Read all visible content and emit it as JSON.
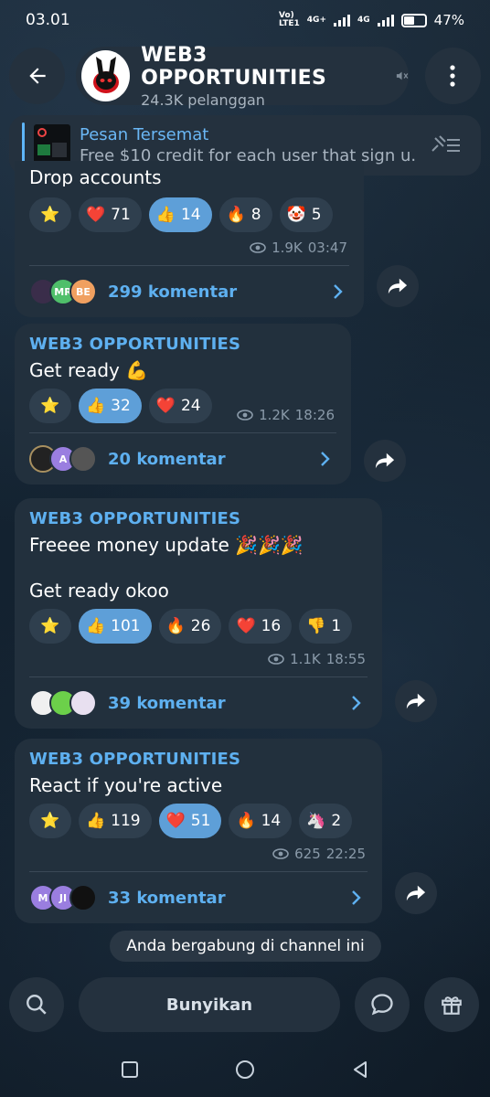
{
  "status": {
    "time": "03.01",
    "net_top": "Vo)",
    "net_bottom": "LTE1",
    "gen1": "4G+",
    "gen2": "4G",
    "battery": "47%"
  },
  "header": {
    "channel_name": "WEB3 OPPORTUNITIES",
    "subscribers": "24.3K pelanggan"
  },
  "pinned": {
    "title": "Pesan Tersemat",
    "text": "Free $10 credit for each user that sign u..."
  },
  "posts": [
    {
      "text": "Drop accounts",
      "reactions": [
        {
          "icon": "star",
          "count": ""
        },
        {
          "icon": "heart",
          "count": "71"
        },
        {
          "icon": "thumbs-up",
          "count": "14",
          "active": true
        },
        {
          "icon": "fire",
          "count": "8"
        },
        {
          "icon": "clown",
          "count": "5"
        }
      ],
      "views": "1.9K",
      "time": "03:47",
      "comments": "299 komentar"
    },
    {
      "sender": "WEB3 OPPORTUNITIES",
      "text": "Get ready 💪",
      "reactions": [
        {
          "icon": "star",
          "count": ""
        },
        {
          "icon": "thumbs-up",
          "count": "32",
          "active": true
        },
        {
          "icon": "heart",
          "count": "24"
        }
      ],
      "views": "1.2K",
      "time": "18:26",
      "comments": "20 komentar"
    },
    {
      "sender": "WEB3 OPPORTUNITIES",
      "text": "Freeee money update 🎉🎉🎉",
      "text2": "Get ready okoo",
      "reactions": [
        {
          "icon": "star",
          "count": ""
        },
        {
          "icon": "thumbs-up",
          "count": "101",
          "active": true
        },
        {
          "icon": "fire",
          "count": "26"
        },
        {
          "icon": "heart",
          "count": "16"
        },
        {
          "icon": "thumbs-down",
          "count": "1"
        }
      ],
      "views": "1.1K",
      "time": "18:55",
      "comments": "39 komentar"
    },
    {
      "sender": "WEB3 OPPORTUNITIES",
      "text": "React if you're active",
      "reactions": [
        {
          "icon": "star",
          "count": ""
        },
        {
          "icon": "thumbs-up",
          "count": "119"
        },
        {
          "icon": "heart",
          "count": "51",
          "active": true
        },
        {
          "icon": "fire",
          "count": "14"
        },
        {
          "icon": "unicorn",
          "count": "2"
        }
      ],
      "views": "625",
      "time": "22:25",
      "comments": "33 komentar"
    }
  ],
  "joined_notice": "Anda bergabung di channel ini",
  "bottom": {
    "mute_label": "Bunyikan"
  },
  "avatars": {
    "post1": [
      "",
      "MR",
      "BE"
    ],
    "post2": [
      "",
      "A",
      ""
    ],
    "post3": [
      "",
      "",
      ""
    ],
    "post4": [
      "M",
      "JI",
      ""
    ]
  },
  "colors": {
    "accent": "#5eb0f0",
    "bubble": "#22303d",
    "active_reaction": "#5e9fd8"
  }
}
